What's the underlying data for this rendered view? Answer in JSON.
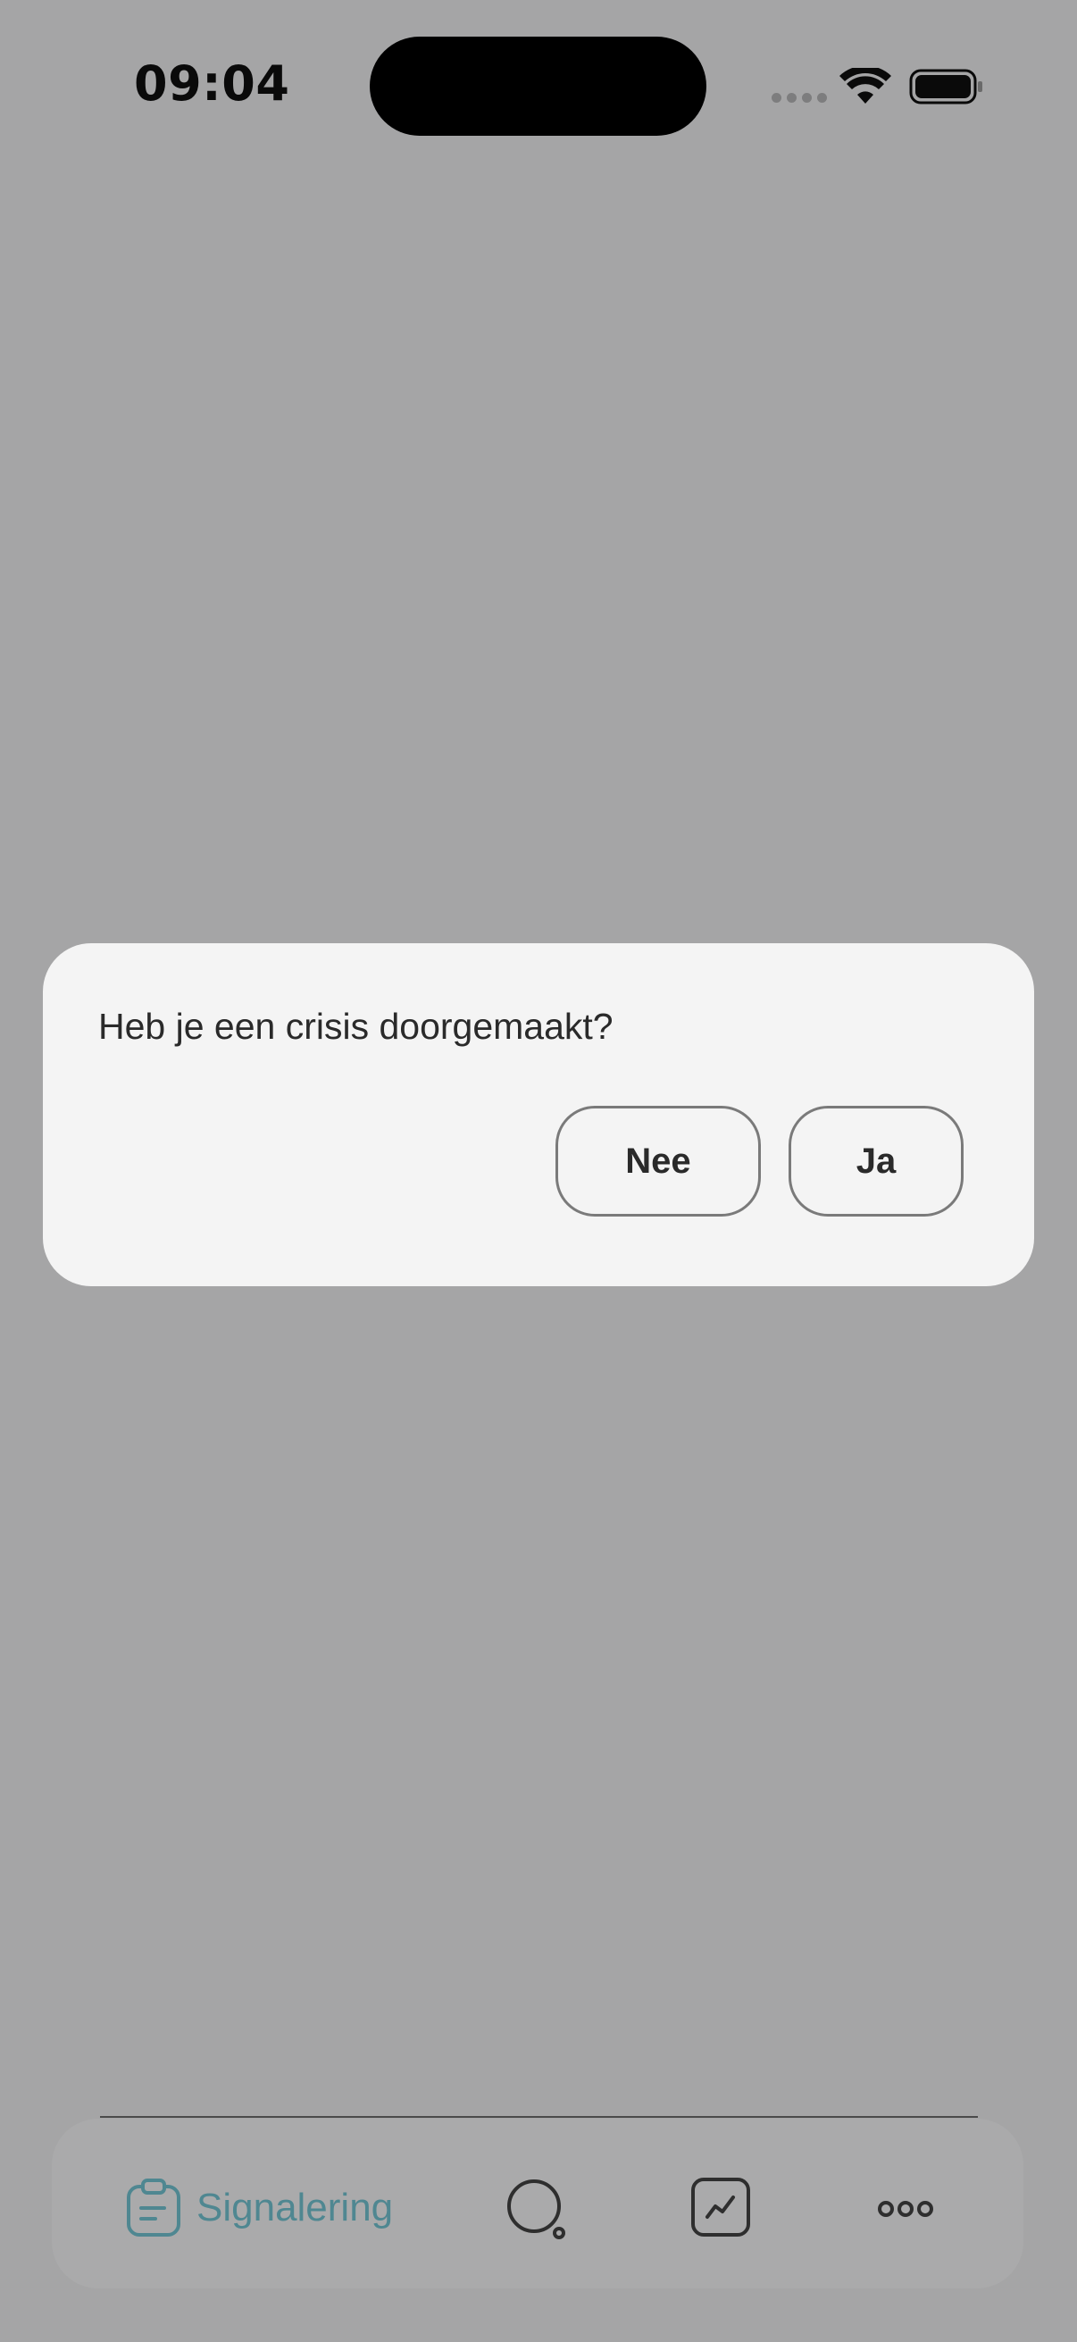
{
  "status_bar": {
    "time": "09:04"
  },
  "dialog": {
    "question": "Heb je een crisis doorgemaakt?",
    "buttons": {
      "no": "Nee",
      "yes": "Ja"
    }
  },
  "tab_bar": {
    "items": [
      {
        "label": "Signalering",
        "icon": "clipboard-icon",
        "active": true
      },
      {
        "label": "",
        "icon": "search-icon",
        "active": false
      },
      {
        "label": "",
        "icon": "chart-icon",
        "active": false
      },
      {
        "label": "",
        "icon": "more-icon",
        "active": false
      }
    ]
  },
  "colors": {
    "overlay_background": "#a5a5a6",
    "dialog_background": "#f4f4f4",
    "active_tab": "#4f8791",
    "text": "#2a2a2a"
  }
}
